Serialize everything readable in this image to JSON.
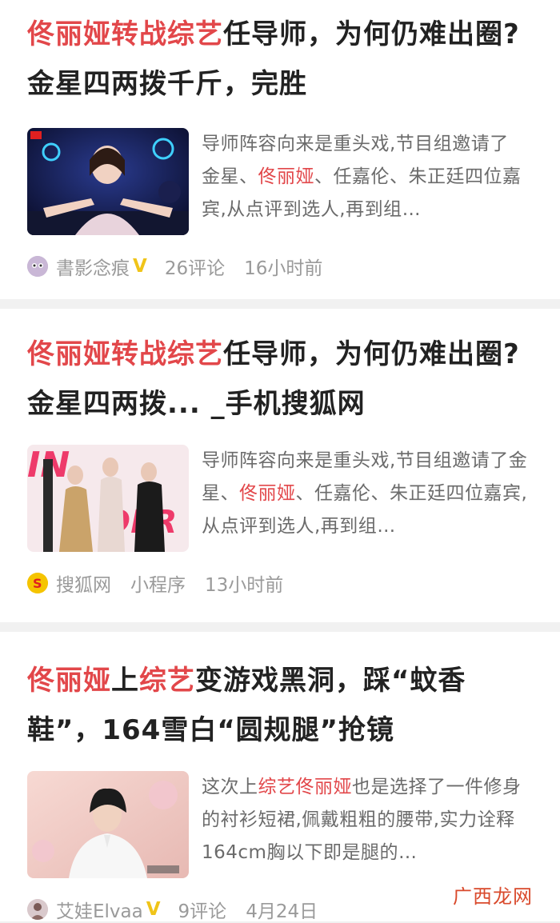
{
  "articles": [
    {
      "title_hl": "佟丽娅转战综艺",
      "title_rest": "任导师，为何仍难出圈?金星四两拨千斤，完胜",
      "snippet": [
        {
          "t": "导师阵容向来是重头戏,节目组邀请了 金星、",
          "hl": false
        },
        {
          "t": "佟丽娅",
          "hl": true
        },
        {
          "t": "、任嘉伦、朱正廷四位嘉宾,从点评到选人,再到组…",
          "hl": false
        }
      ],
      "author": "書影念痕",
      "verified": "V",
      "comments": "26评论",
      "time": "16小时前"
    },
    {
      "title_hl": "佟丽娅转战综艺",
      "title_rest": "任导师，为何仍难出圈?金星四两拨... _手机搜狐网",
      "snippet": [
        {
          "t": "导师阵容向来是重头戏,节目组邀请了金星、",
          "hl": false
        },
        {
          "t": "佟丽娅",
          "hl": true
        },
        {
          "t": "、任嘉伦、朱正廷四位嘉宾,从点评到选人,再到组…",
          "hl": false
        }
      ],
      "author": "搜狐网",
      "badge": "小程序",
      "time": "13小时前"
    },
    {
      "title_parts": [
        {
          "t": "佟丽娅",
          "hl": true
        },
        {
          "t": "上",
          "hl": false
        },
        {
          "t": "综艺",
          "hl": true
        },
        {
          "t": "变游戏黑洞，踩“蚊香鞋”，164雪白“圆规腿”抢镜",
          "hl": false
        }
      ],
      "snippet": [
        {
          "t": "这次上",
          "hl": false
        },
        {
          "t": "综艺佟丽娅",
          "hl": true
        },
        {
          "t": "也是选择了一件修身的衬衫短裙,佩戴粗粗的腰带,实力诠释164cm胸以下即是腿的…",
          "hl": false
        }
      ],
      "author": "艾娃Elvaa",
      "verified": "V",
      "comments": "9评论",
      "time": "4月24日"
    }
  ],
  "watermark": "广西龙网",
  "colors": {
    "highlight": "#e2474a",
    "verified": "#f0c419",
    "meta": "#9a9a9a"
  }
}
